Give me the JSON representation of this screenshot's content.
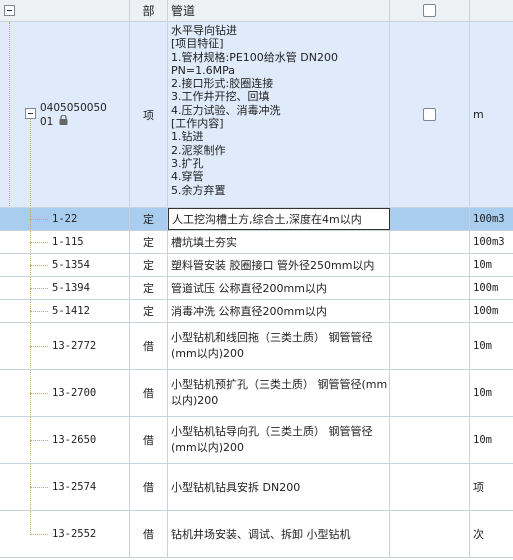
{
  "header": {
    "col_type": "部",
    "col_name": "管道"
  },
  "parent": {
    "code_line1": "0405050050",
    "code_line2": "01",
    "type": "项",
    "unit": "m",
    "description": "水平导向钻进\n[项目特征]\n1.管材规格:PE100给水管 DN200\nPN=1.6MPa\n2.接口形式:胶圈连接\n3.工作井开挖、回填\n4.压力试验、消毒冲洗\n[工作内容]\n1.钻进\n2.泥浆制作\n3.扩孔\n4.穿管\n5.余方弃置"
  },
  "rows": [
    {
      "code": "1-22",
      "type": "定",
      "name": "人工挖沟槽土方,综合土,深度在4m以内",
      "unit": "100m3"
    },
    {
      "code": "1-115",
      "type": "定",
      "name": "槽坑填土夯实",
      "unit": "100m3"
    },
    {
      "code": "5-1354",
      "type": "定",
      "name": "塑料管安装 胶圈接口 管外径250mm以内",
      "unit": "10m"
    },
    {
      "code": "5-1394",
      "type": "定",
      "name": "管道试压 公称直径200mm以内",
      "unit": "100m"
    },
    {
      "code": "5-1412",
      "type": "定",
      "name": "消毒冲洗 公称直径200mm以内",
      "unit": "100m"
    },
    {
      "code": "13-2772",
      "type": "借",
      "name": "小型钻机和线回拖（三类土质） 钢管管径(mm以内)200",
      "unit": "10m"
    },
    {
      "code": "13-2700",
      "type": "借",
      "name": "小型钻机预扩孔（三类土质） 钢管管径(mm以内)200",
      "unit": "10m"
    },
    {
      "code": "13-2650",
      "type": "借",
      "name": "小型钻机钻导向孔（三类土质） 钢管管径(mm以内)200",
      "unit": "10m"
    },
    {
      "code": "13-2574",
      "type": "借",
      "name": "小型钻机钻具安拆 DN200",
      "unit": "项"
    },
    {
      "code": "13-2552",
      "type": "借",
      "name": "钻机井场安装、调试、拆卸 小型钻机",
      "unit": "次"
    }
  ]
}
